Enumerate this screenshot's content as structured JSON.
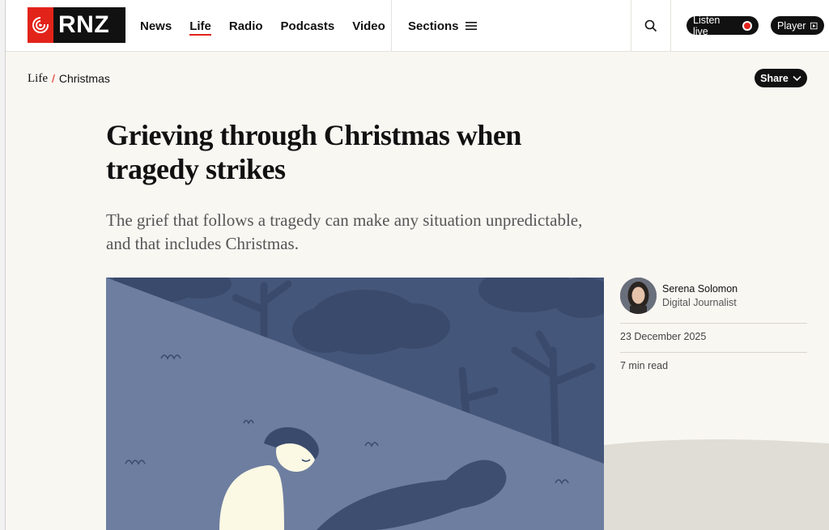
{
  "header": {
    "logo_text": "RNZ",
    "nav": [
      {
        "label": "News"
      },
      {
        "label": "Life"
      },
      {
        "label": "Radio"
      },
      {
        "label": "Podcasts"
      },
      {
        "label": "Video"
      }
    ],
    "sections_label": "Sections",
    "listen_label": "Listen live",
    "player_label": "Player"
  },
  "breadcrumb": {
    "section": "Life",
    "separator": "/",
    "category": "Christmas"
  },
  "share_label": "Share",
  "article": {
    "title": "Grieving through Christmas when tragedy strikes",
    "standfirst": "The grief that follows a tragedy can make any situation unpredictable, and that includes Christmas."
  },
  "byline": {
    "author": "Serena Solomon",
    "role": "Digital Journalist",
    "date": "23 December 2025",
    "read_time": "7 min read"
  },
  "colors": {
    "brand_red": "#e2231a",
    "hero_dark": "#44567a",
    "hero_light": "#6e7ea0",
    "page_bg": "#f9f7f2"
  },
  "icons": [
    "rnz-logo-icon",
    "menu-icon",
    "search-icon",
    "record-icon",
    "play-icon",
    "chevron-down-icon"
  ]
}
